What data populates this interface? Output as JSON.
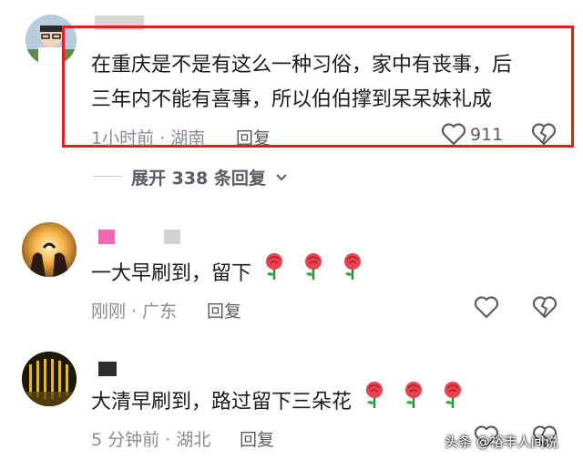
{
  "comments": [
    {
      "text_line1": "在重庆是不是有这么一种习俗，家中有丧事，后",
      "text_line2": "三年内不能有喜事，所以伯伯撑到呆呆妹礼成",
      "meta": "1小时前 · 湖南",
      "reply_label": "回复",
      "like_count": "911"
    },
    {
      "text": "一大早刷到，留下",
      "flowers": [
        "rose-emoji",
        "rose-emoji",
        "rose-emoji"
      ],
      "meta": "刚刚 · 广东",
      "reply_label": "回复"
    },
    {
      "text": "大清早刷到，路过留下三朵花",
      "flowers": [
        "rose-emoji",
        "rose-emoji",
        "rose-emoji"
      ],
      "meta": "5 分钟前 · 湖北",
      "reply_label": "回复"
    }
  ],
  "expand_replies": "展开 338 条回复",
  "watermark": "头条 @裕丰人间说",
  "colors": {
    "highlight_border": "#e0201b",
    "meta_text": "#8a8b91",
    "rose": "#e8424f"
  },
  "icons": [
    "heart-icon",
    "dislike-icon",
    "chevron-down-icon"
  ]
}
